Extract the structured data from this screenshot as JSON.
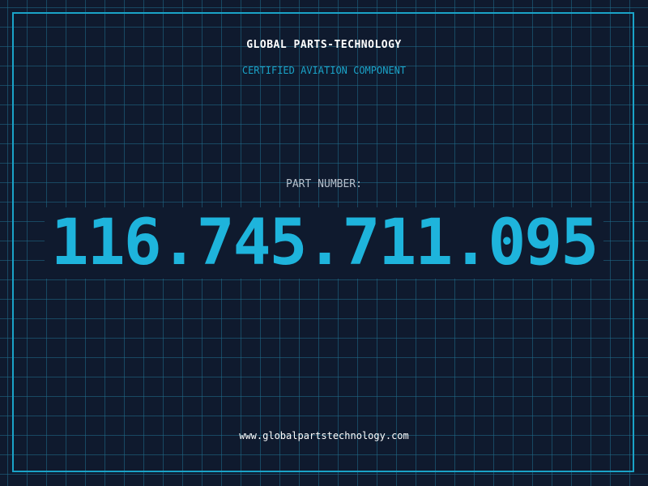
{
  "header": {
    "company_name": "GLOBAL PARTS-TECHNOLOGY",
    "tagline": "CERTIFIED AVIATION COMPONENT"
  },
  "part": {
    "label": "PART NUMBER:",
    "number": "116.745.711.095"
  },
  "footer": {
    "url": "www.globalpartstechnology.com"
  },
  "colors": {
    "background": "#0f1a2e",
    "grid": "#206e8c",
    "accent": "#1aa3c8",
    "part_number": "#1eb4dc",
    "heading": "#ffffff",
    "label": "#b7c0cc"
  }
}
